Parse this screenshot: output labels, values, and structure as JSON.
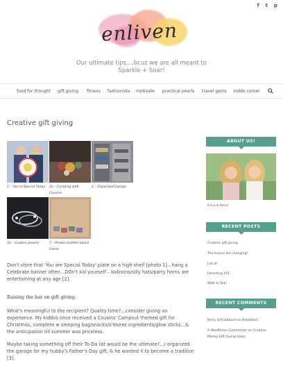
{
  "social": {
    "facebook": "f",
    "twitter": "t",
    "pinterest": "p"
  },
  "site": {
    "logo_text": "enliven",
    "tagline_line1": "Our ultimate tips....bcuz we are all meant to",
    "tagline_line2": "Sparkle + Soar!"
  },
  "nav": {
    "items": [
      "food for thought",
      "gift giving",
      "fitness",
      "fashionista",
      "motivate",
      "practical pearls",
      "travel gems",
      "kiddo corner"
    ]
  },
  "post": {
    "title": "Creative gift giving",
    "captions": [
      "1 – You're Special Today",
      "2a – Camping with Cousins",
      "3 – Organized Garage",
      "3a – Custom jewelry",
      "7 – Photos bulletin board frame"
    ],
    "para1": "Don't store that 'You are Special Today' plate on a high shelf [photo 1]…hang a Celebrate banner often…DOn't kid yourself – balloons/silly hats/party horns are entertaining at any age [2].",
    "heading": "Raising the bar on gift giving.",
    "para2": "What's meaningful to the recipient? Quality time?…consider giving an experience. My kiddos once received a Cousins' Campout themed gift for Christmas, complete w sleeping bag/snacks/s'mores ingredients/glow sticks…& the anticipation till summer was priceless.",
    "para3": "Maybe taking something off their To-Do list would be the ultimate?…I organized the garage for my hubby's Father's Day gift, & he wanted it to become a tradition [3]."
  },
  "sidebar": {
    "about_title": "ABOUT US!",
    "about_caption": "Erica & Kerry",
    "recent_posts_title": "RECENT POSTS",
    "recent_posts": [
      "Creative gift giving",
      "The leaves are changing!",
      "List It!",
      "Parenting 101",
      "Walk & Talk!"
    ],
    "recent_comments_title": "RECENT COMMENTS",
    "recent_comments": [
      "Kerry Schnabbach on Breakfast",
      "A WordPress Commenter on Creative",
      "Money Gift Giving Ideas"
    ]
  }
}
